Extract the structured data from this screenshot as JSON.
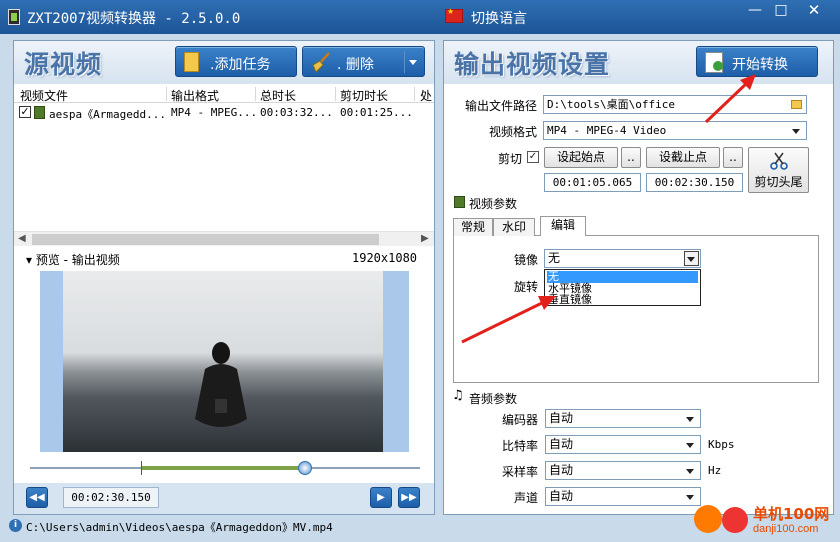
{
  "window": {
    "title": "ZXT2007视频转换器 - 2.5.0.0",
    "language_button": "切换语言",
    "min_label": "—",
    "max_label": "□",
    "close_label": "✕"
  },
  "left": {
    "title": "源视频",
    "add_task_label": ".添加任务",
    "delete_label": ".    删除",
    "columns": [
      "视频文件",
      "输出格式",
      "总时长",
      "剪切时长",
      "处"
    ],
    "rows": [
      {
        "checked": true,
        "file": "aespa《Armagedd...",
        "format": "MP4 - MPEG...",
        "total": "00:03:32...",
        "cut": "00:01:25..."
      }
    ],
    "preview_label": "预览 - 输出视频",
    "resolution": "1920x1080",
    "current_time": "00:02:30.150",
    "playhead_fraction": 0.705
  },
  "right": {
    "title": "输出视频设置",
    "start_label": "开始转换",
    "output_path_label": "输出文件路径",
    "output_path": "D:\\tools\\桌面\\office",
    "video_format_label": "视频格式",
    "video_format": "MP4 - MPEG-4 Video",
    "cut_label": "剪切",
    "cut_checked": true,
    "set_start_label": "设起始点",
    "set_end_label": "设截止点",
    "dots": "..",
    "start_time": "00:01:05.065",
    "end_time": "00:02:30.150",
    "cut_head_tail_label": "剪切头尾",
    "video_params_label": "视频参数",
    "tabs": [
      "常规",
      "水印",
      "编辑"
    ],
    "active_tab": "编辑",
    "mirror_label": "镜像",
    "mirror_value": "无",
    "rotate_label": "旋转",
    "mirror_options": [
      "无",
      "水平镜像",
      "垂直镜像"
    ],
    "audio_params_label": "音频参数",
    "encoder_label": "编码器",
    "encoder_value": "自动",
    "bitrate_label": "比特率",
    "bitrate_value": "自动",
    "bitrate_unit": "Kbps",
    "samplerate_label": "采样率",
    "samplerate_value": "自动",
    "samplerate_unit": "Hz",
    "channel_label": "声道",
    "channel_value": "自动"
  },
  "status": {
    "path": "C:\\Users\\admin\\Videos\\aespa《Armageddon》MV.mp4"
  },
  "watermark": {
    "text1": "单机100网",
    "text2": "danji100.com"
  },
  "colors": {
    "title_bar": "#1d5597",
    "accent_blue": "#1d5ea8",
    "selection": "#3399ff",
    "arrow_red": "#e3211c"
  }
}
